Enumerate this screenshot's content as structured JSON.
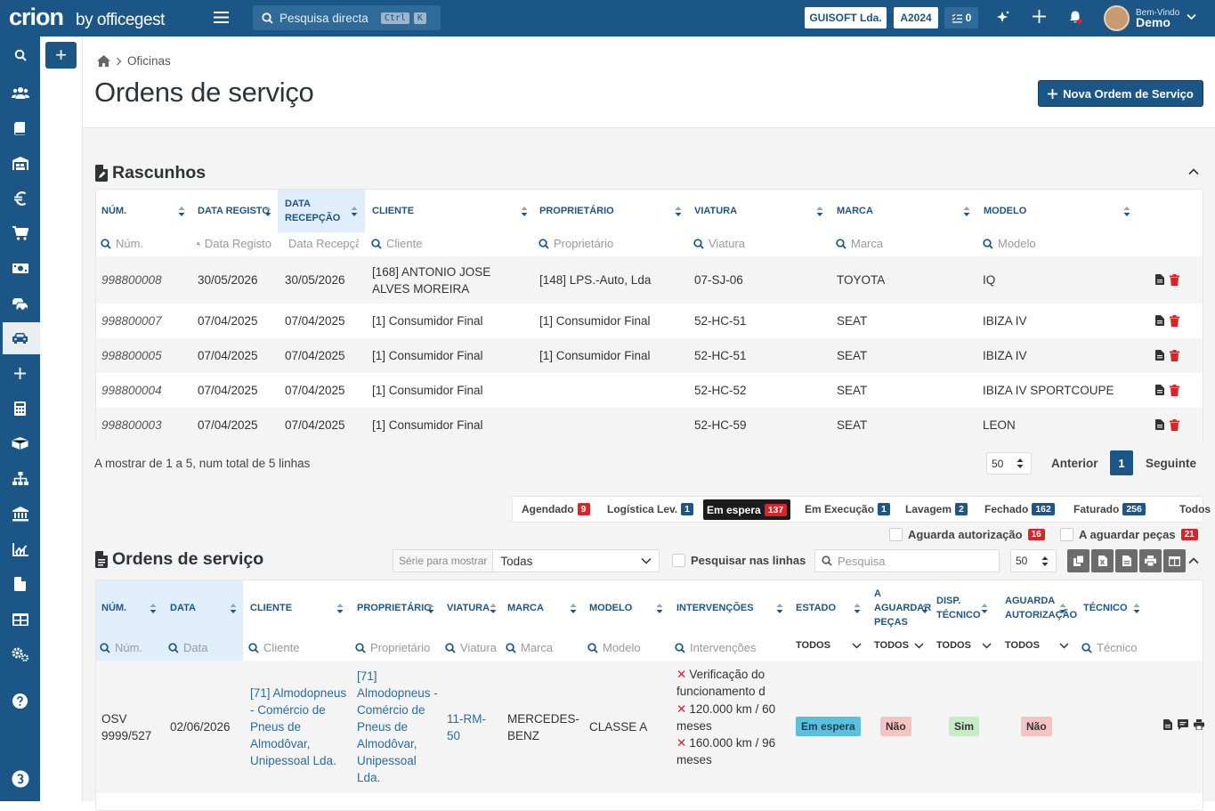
{
  "topbar": {
    "brand": "crion",
    "by": "by officegest",
    "search_placeholder": "Pesquisa directa",
    "kbd1": "Ctrl",
    "kbd2": "K",
    "company": "GUISOFT Lda.",
    "year": "A2024",
    "task_count": "0",
    "greeting": "Bem-Vindo",
    "user": "Demo"
  },
  "breadcrumb": {
    "current": "Oficinas"
  },
  "page": {
    "title": "Ordens de serviço",
    "new_button": "Nova Ordem de Serviço"
  },
  "drafts": {
    "title": "Rascunhos",
    "columns": [
      "NÚM.",
      "DATA REGISTO",
      "DATA RECEPÇÃO",
      "CLIENTE",
      "PROPRIETÁRIO",
      "VIATURA",
      "MARCA",
      "MODELO"
    ],
    "filters": [
      "Núm.",
      "Data Registo",
      "Data Recepção",
      "Cliente",
      "Proprietário",
      "Viatura",
      "Marca",
      "Modelo"
    ],
    "rows": [
      {
        "num": "998800008",
        "data_registo": "30/05/2026",
        "data_recepcao": "30/05/2026",
        "cliente": "[168] ANTONIO JOSE ALVES MOREIRA",
        "proprietario": "[148] LPS.-Auto, Lda",
        "viatura": "07-SJ-06",
        "marca": "TOYOTA",
        "modelo": "IQ"
      },
      {
        "num": "998800007",
        "data_registo": "07/04/2025",
        "data_recepcao": "07/04/2025",
        "cliente": "[1] Consumidor Final",
        "proprietario": "[1] Consumidor Final",
        "viatura": "52-HC-51",
        "marca": "SEAT",
        "modelo": "IBIZA IV"
      },
      {
        "num": "998800005",
        "data_registo": "07/04/2025",
        "data_recepcao": "07/04/2025",
        "cliente": "[1] Consumidor Final",
        "proprietario": "[1] Consumidor Final",
        "viatura": "52-HC-51",
        "marca": "SEAT",
        "modelo": "IBIZA IV"
      },
      {
        "num": "998800004",
        "data_registo": "07/04/2025",
        "data_recepcao": "07/04/2025",
        "cliente": "[1] Consumidor Final",
        "proprietario": "",
        "viatura": "52-HC-52",
        "marca": "SEAT",
        "modelo": "IBIZA IV SPORTCOUPE"
      },
      {
        "num": "998800003",
        "data_registo": "07/04/2025",
        "data_recepcao": "07/04/2025",
        "cliente": "[1] Consumidor Final",
        "proprietario": "",
        "viatura": "52-HC-59",
        "marca": "SEAT",
        "modelo": "LEON"
      }
    ],
    "info": "A mostrar de 1 a 5, num total de 5 linhas",
    "page_size": "50",
    "prev": "Anterior",
    "page": "1",
    "next": "Seguinte"
  },
  "status_filters": [
    {
      "label": "Agendado",
      "count": "9",
      "color": "#d9242a"
    },
    {
      "label": "Logística Lev.",
      "count": "1",
      "color": "#1c5686"
    },
    {
      "label": "Em espera",
      "count": "137",
      "color": "#d9242a",
      "active": true
    },
    {
      "label": "Em Execução",
      "count": "1",
      "color": "#1c5686"
    },
    {
      "label": "Lavagem",
      "count": "2",
      "color": "#1c5686"
    },
    {
      "label": "Fechado",
      "count": "162",
      "color": "#1c5686"
    },
    {
      "label": "Faturado",
      "count": "256",
      "color": "#1c5686"
    },
    {
      "label": "Todos",
      "count": ""
    }
  ],
  "checks": {
    "aguarda_autorizacao": "Aguarda autorização",
    "aguarda_autorizacao_count": "16",
    "aguardar_pecas": "A aguardar peças",
    "aguardar_pecas_count": "21"
  },
  "orders": {
    "title": "Ordens de serviço",
    "serie_label": "Série para mostrar",
    "serie_value": "Todas",
    "search_lines": "Pesquisar nas linhas",
    "search_placeholder": "Pesquisa",
    "page_size": "50",
    "columns": [
      "NÚM.",
      "DATA",
      "CLIENTE",
      "PROPRIETÁRIO",
      "VIATURA",
      "MARCA",
      "MODELO",
      "INTERVENÇÕES",
      "ESTADO",
      "A AGUARDAR PEÇAS",
      "DISP. TÉCNICO",
      "AGUARDA AUTORIZAÇÃO",
      "TÉCNICO"
    ],
    "filters": [
      "Núm.",
      "Data",
      "Cliente",
      "Proprietário",
      "Viatura",
      "Marca",
      "Modelo",
      "Intervenções",
      "TODOS",
      "TODOS",
      "TODOS",
      "TODOS",
      "Técnico"
    ],
    "row": {
      "num": "OSV 9999/527",
      "data": "02/06/2026",
      "cliente": "[71] Almodopneus - Comércio de Pneus de Almodôvar, Unipessoal Lda.",
      "proprietario": "[71] Almodopneus - Comércio de Pneus de Almodôvar, Unipessoal Lda.",
      "viatura": "11-RM-50",
      "marca": "MERCEDES-BENZ",
      "modelo": "CLASSE A",
      "intervencoes": [
        "Verificação do funcionamento d",
        "120.000 km / 60 meses",
        "160.000 km / 96 meses"
      ],
      "estado": "Em espera",
      "aguardar_pecas": "Não",
      "disp_tecnico": "Sim",
      "aguarda_autorizacao": "Não"
    }
  },
  "colors": {
    "primary": "#1c5686",
    "danger": "#d9242a",
    "info": "#5bc0de"
  }
}
